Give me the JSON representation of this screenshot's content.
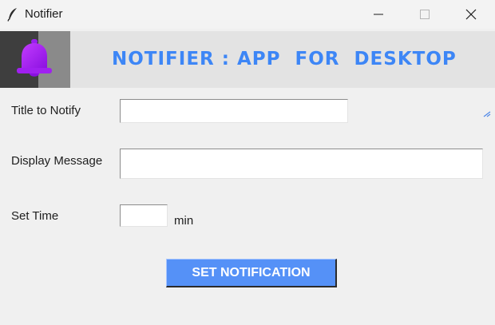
{
  "window": {
    "title": "Notifier",
    "controls": {
      "minimize_icon": "minimize-icon",
      "maximize_icon": "maximize-icon",
      "close_icon": "close-icon"
    }
  },
  "banner": {
    "icon": "bell-icon",
    "title": "NOTIFIER : APP  FOR  DESKTOP",
    "title_color": "#3d86f6",
    "bell_color": "#a020f0"
  },
  "form": {
    "title_label": "Title to Notify",
    "title_value": "",
    "message_label": "Display Message",
    "message_value": "",
    "time_label": "Set Time",
    "time_value": "",
    "time_unit": "min"
  },
  "actions": {
    "set_notification_label": "SET NOTIFICATION",
    "button_color": "#5591f7"
  }
}
